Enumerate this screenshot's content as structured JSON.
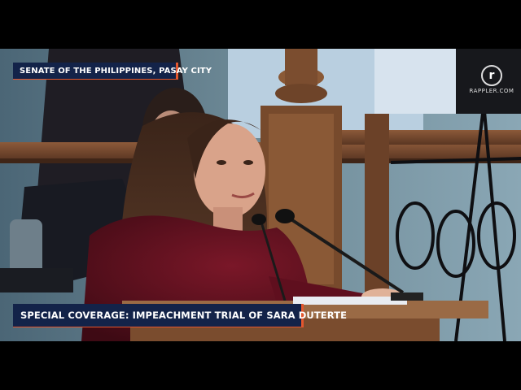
{
  "broadcast": {
    "location_caption": "SENATE OF THE PHILIPPINES, PASAY CITY",
    "program_caption": "SPECIAL COVERAGE: IMPEACHMENT TRIAL OF SARA DUTERTE",
    "network_logo_mark": "r",
    "network_logo_text": "RAPPLER.COM"
  },
  "colors": {
    "caption_background": "#132349",
    "caption_accent": "#e4572e",
    "caption_text": "#ffffff"
  }
}
